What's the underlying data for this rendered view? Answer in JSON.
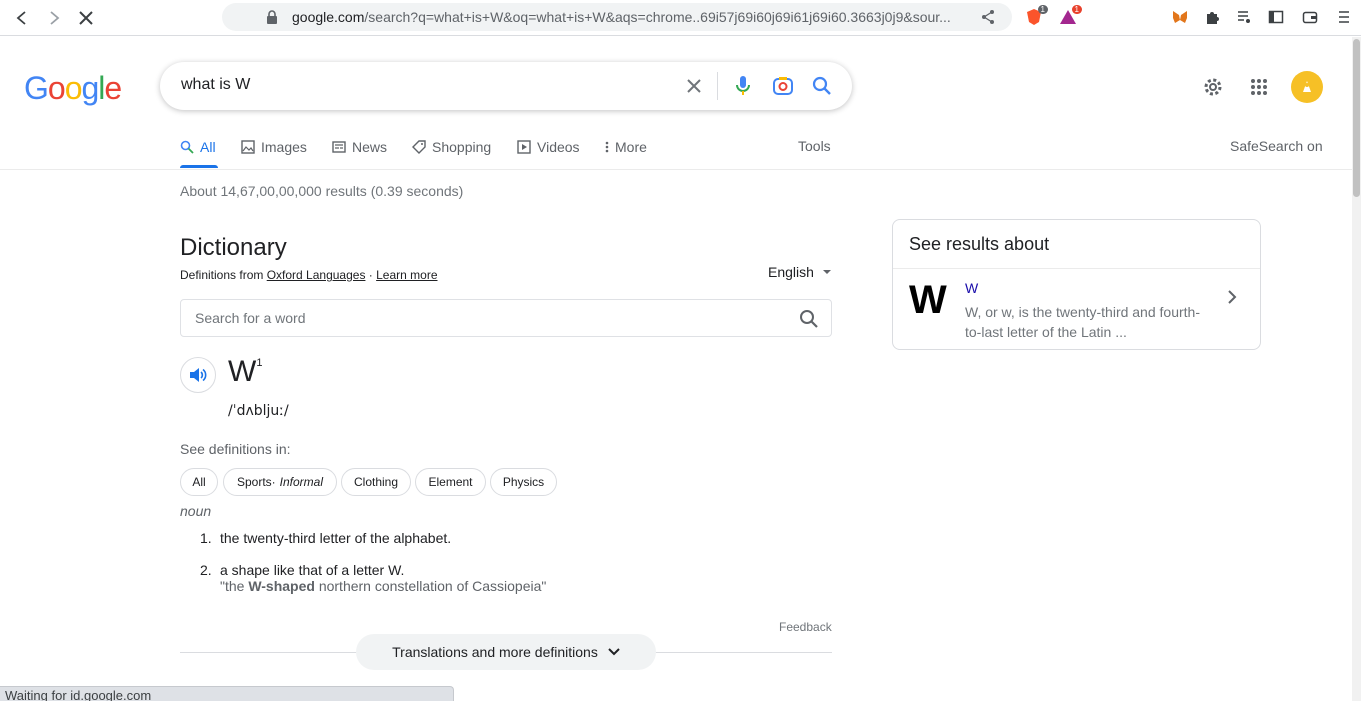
{
  "browser": {
    "url_host": "google.com",
    "url_rest": "/search?q=what+is+W&oq=what+is+W&aqs=chrome..69i57j69i60j69i61j69i60.3663j0j9&sour...",
    "status_text": "Waiting for id.google.com",
    "ext_badge_1": "1",
    "ext_badge_2": "1"
  },
  "google": {
    "logo_letters": [
      "G",
      "o",
      "o",
      "g",
      "l",
      "e"
    ],
    "logo_colors": [
      "#4285f4",
      "#ea4335",
      "#fbbc05",
      "#4285f4",
      "#34a853",
      "#ea4335"
    ],
    "query": "what is W"
  },
  "tabs": [
    {
      "label": "All",
      "icon": "search-icon"
    },
    {
      "label": "Images",
      "icon": "image-icon"
    },
    {
      "label": "News",
      "icon": "news-icon"
    },
    {
      "label": "Shopping",
      "icon": "tag-icon"
    },
    {
      "label": "Videos",
      "icon": "play-icon"
    },
    {
      "label": "More",
      "icon": "more-vert-icon"
    }
  ],
  "tools_label": "Tools",
  "safesearch_label": "SafeSearch on",
  "result_stats": "About 14,67,00,00,000 results (0.39 seconds)",
  "dictionary": {
    "title": "Dictionary",
    "source_prefix": "Definitions from ",
    "source_name": "Oxford Languages",
    "source_sep": " · ",
    "learn_more": "Learn more",
    "language": "English",
    "search_placeholder": "Search for a word",
    "headword": "W",
    "homograph": "1",
    "ipa": "/ˈdʌbljuː/",
    "see_defs_label": "See definitions in:",
    "chips": [
      {
        "label": "All",
        "note": ""
      },
      {
        "label": "Sports",
        "note": "Informal"
      },
      {
        "label": "Clothing",
        "note": ""
      },
      {
        "label": "Element",
        "note": ""
      },
      {
        "label": "Physics",
        "note": ""
      }
    ],
    "chip_sep": " · ",
    "part_of_speech": "noun",
    "definitions": [
      {
        "num": "1.",
        "text": "the twenty-third letter of the alphabet."
      },
      {
        "num": "2.",
        "text": "a shape like that of a letter W."
      }
    ],
    "example_prefix": "\"the ",
    "example_bold": "W-shaped",
    "example_suffix": " northern constellation of Cassiopeia\"",
    "feedback": "Feedback",
    "more_button": "Translations and more definitions"
  },
  "knowledge_panel": {
    "title": "See results about",
    "letter": "W",
    "link": "W",
    "description": "W, or w, is the twenty-third and fourth-to-last letter of the Latin ..."
  }
}
